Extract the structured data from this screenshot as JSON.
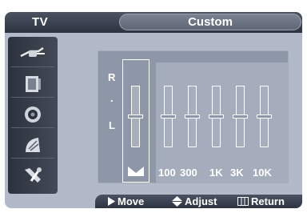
{
  "header": {
    "menu_label": "TV",
    "title": "Custom"
  },
  "sidebar": {
    "items": [
      {
        "icon": "antenna-plug-icon"
      },
      {
        "icon": "picture-icon"
      },
      {
        "icon": "speaker-icon"
      },
      {
        "icon": "satellite-dish-icon"
      },
      {
        "icon": "tools-icon"
      }
    ]
  },
  "balance": {
    "label_top": "R",
    "label_mid": ".",
    "label_bottom": "L",
    "level": 0.5
  },
  "equalizer": {
    "bands": [
      {
        "label": "100",
        "level": 0.5
      },
      {
        "label": "300",
        "level": 0.5
      },
      {
        "label": "1K",
        "level": 0.5
      },
      {
        "label": "3K",
        "level": 0.5
      },
      {
        "label": "10K",
        "level": 0.5
      }
    ]
  },
  "footer": {
    "move": "Move",
    "adjust": "Adjust",
    "return": "Return"
  }
}
